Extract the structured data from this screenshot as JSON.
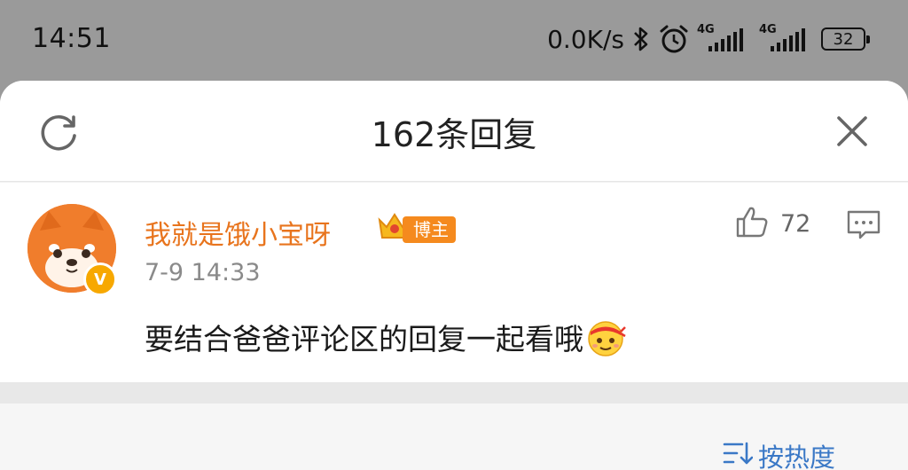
{
  "status_bar": {
    "time": "14:51",
    "network_speed": "0.0K/s",
    "signal_1_label": "4G",
    "signal_2_label": "4G",
    "battery": "32"
  },
  "sheet": {
    "title": "162条回复",
    "refresh_icon": "refresh-icon",
    "close_icon": "close-icon"
  },
  "comment": {
    "username": "我就是饿小宝呀",
    "badge": "博主",
    "verified": "V",
    "timestamp": "7-9 14:33",
    "like_count": "72",
    "content": "要结合爸爸评论区的回复一起看哦",
    "colors": {
      "username": "#e8741d",
      "badge_bg": "#f58a1e"
    }
  },
  "sort": {
    "label": "按热度"
  }
}
